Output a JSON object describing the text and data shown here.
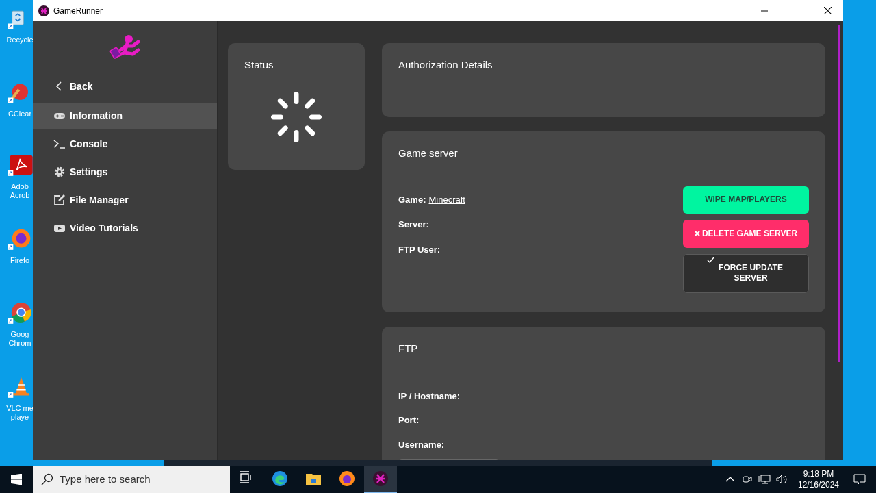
{
  "desktop_icons": [
    {
      "kind": "recycle",
      "lines": [
        "Recycle"
      ]
    },
    {
      "kind": "ccleaner",
      "lines": [
        "CClear"
      ]
    },
    {
      "kind": "acrobat",
      "lines": [
        "Adob",
        "Acrob"
      ]
    },
    {
      "kind": "firefox",
      "lines": [
        "Firefo"
      ]
    },
    {
      "kind": "chrome",
      "lines": [
        "Goog",
        "Chrom"
      ]
    },
    {
      "kind": "vlc",
      "lines": [
        "VLC me",
        "playe"
      ]
    }
  ],
  "window": {
    "title": "GameRunner"
  },
  "sidebar": {
    "items": [
      {
        "kind": "back",
        "label": "Back",
        "selected": false
      },
      {
        "kind": "gamepad",
        "label": "Information",
        "selected": true
      },
      {
        "kind": "terminal",
        "label": "Console",
        "selected": false
      },
      {
        "kind": "gear",
        "label": "Settings",
        "selected": false
      },
      {
        "kind": "edit",
        "label": "File Manager",
        "selected": false
      },
      {
        "kind": "video",
        "label": "Video Tutorials",
        "selected": false
      }
    ]
  },
  "status": {
    "title": "Status"
  },
  "authorization": {
    "title": "Authorization Details"
  },
  "game_server": {
    "title": "Game server",
    "fields": [
      {
        "label": "Game:",
        "value": "Minecraft"
      },
      {
        "label": "Server:"
      },
      {
        "label": "FTP User:"
      }
    ],
    "buttons": [
      {
        "kind": "wipe",
        "label": "WIPE MAP/PLAYERS"
      },
      {
        "kind": "delete",
        "label": "DELETE GAME SERVER"
      },
      {
        "kind": "update",
        "label": "FORCE UPDATE SERVER"
      }
    ]
  },
  "ftp": {
    "title": "FTP",
    "fields": [
      {
        "label": "IP / Hostname:"
      },
      {
        "label": "Port:"
      },
      {
        "label": "Username:"
      }
    ]
  },
  "taskbar": {
    "search": {
      "placeholder": "Type here to search"
    },
    "apps": [
      {
        "kind": "taskview",
        "selected": false
      },
      {
        "kind": "edge",
        "selected": false
      },
      {
        "kind": "explorer",
        "selected": false
      },
      {
        "kind": "firefox",
        "selected": false
      },
      {
        "kind": "gamerunner",
        "selected": true
      }
    ],
    "time": "9:18 PM",
    "date": "12/16/2024"
  }
}
